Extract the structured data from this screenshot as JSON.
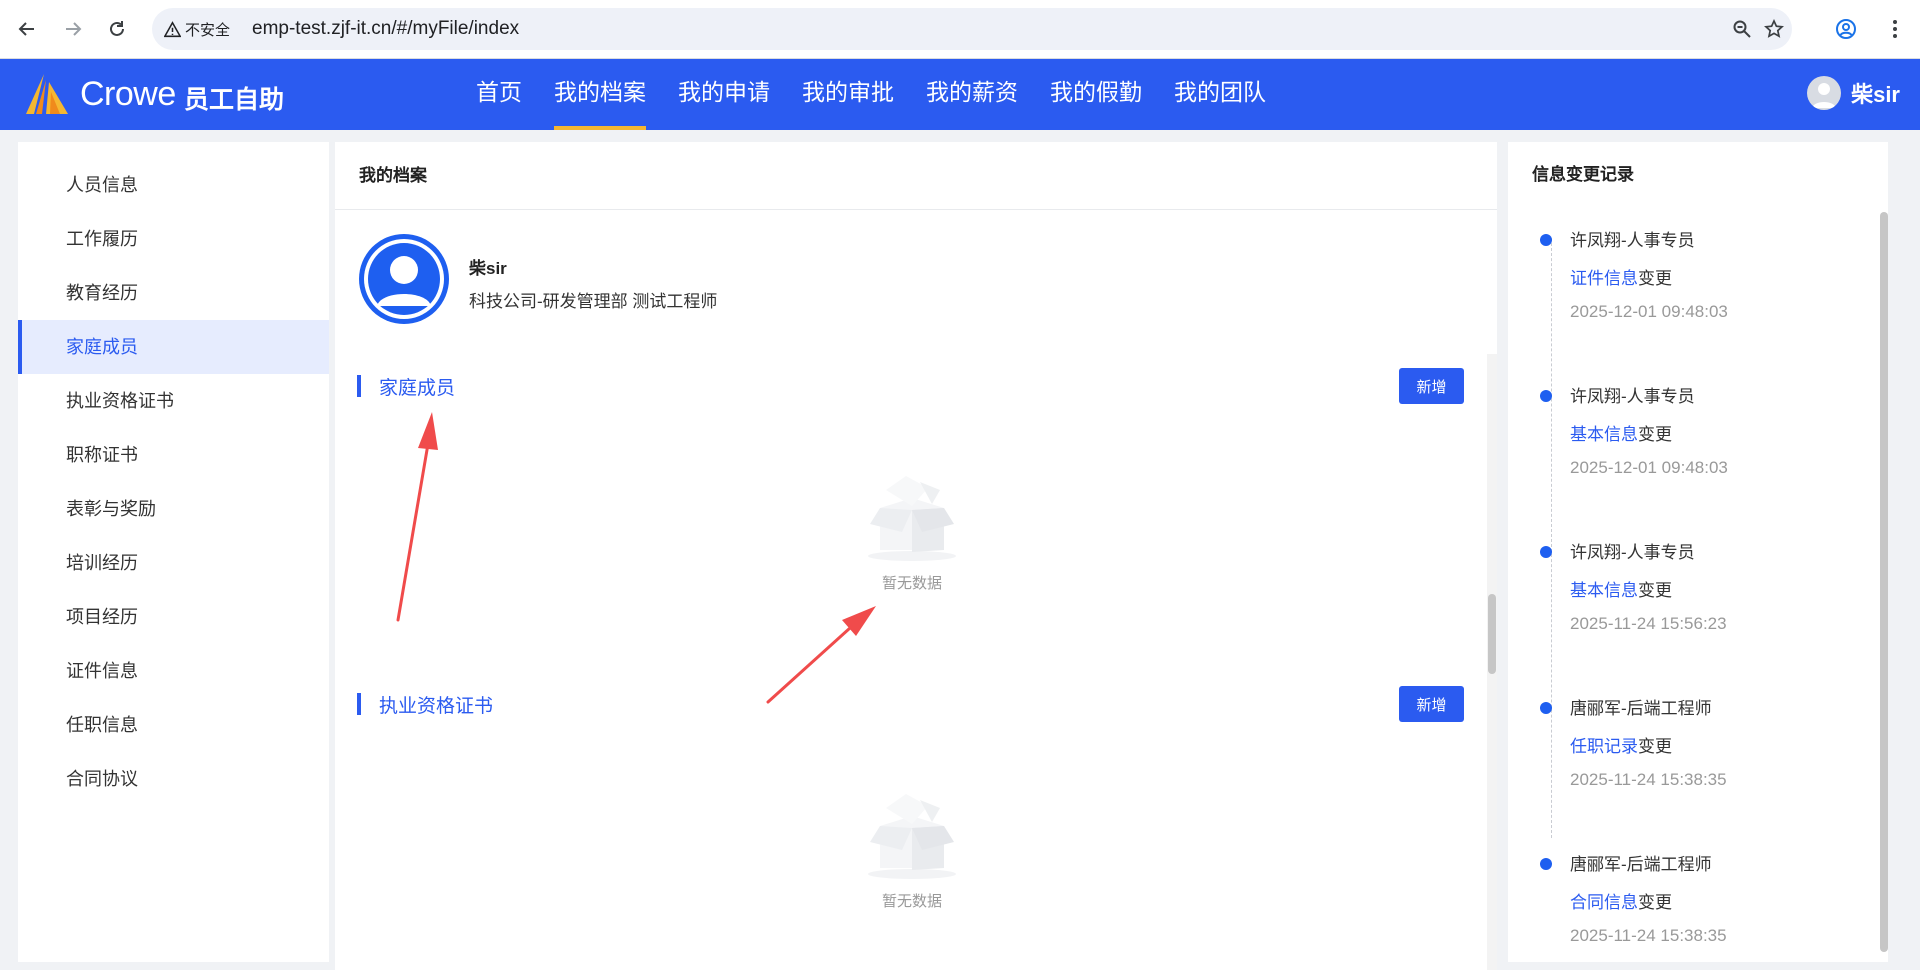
{
  "browser": {
    "security_label": "不安全",
    "url": "emp-test.zjf-it.cn/#/myFile/index"
  },
  "header": {
    "logo_text": "Crowe",
    "logo_sub": "员工自助",
    "nav": [
      {
        "label": "首页"
      },
      {
        "label": "我的档案"
      },
      {
        "label": "我的申请"
      },
      {
        "label": "我的审批"
      },
      {
        "label": "我的薪资"
      },
      {
        "label": "我的假勤"
      },
      {
        "label": "我的团队"
      }
    ],
    "active_nav": "我的档案",
    "user_name": "柴sir",
    "brand_color": "#2b5bf0",
    "active_underline_color": "#f5b731"
  },
  "sidebar": {
    "items": [
      {
        "label": "人员信息"
      },
      {
        "label": "工作履历"
      },
      {
        "label": "教育经历"
      },
      {
        "label": "家庭成员"
      },
      {
        "label": "执业资格证书"
      },
      {
        "label": "职称证书"
      },
      {
        "label": "表彰与奖励"
      },
      {
        "label": "培训经历"
      },
      {
        "label": "项目经历"
      },
      {
        "label": "证件信息"
      },
      {
        "label": "任职信息"
      },
      {
        "label": "合同协议"
      }
    ],
    "active_item": "家庭成员"
  },
  "main": {
    "title": "我的档案",
    "profile": {
      "name": "柴sir",
      "dept": "科技公司-研发管理部 测试工程师"
    },
    "sections": [
      {
        "title": "家庭成员",
        "add_label": "新增",
        "empty_text": "暂无数据"
      },
      {
        "title": "执业资格证书",
        "add_label": "新增",
        "empty_text": "暂无数据"
      }
    ]
  },
  "right": {
    "title": "信息变更记录",
    "records": [
      {
        "who": "许凤翔-人事专员",
        "link": "证件信息",
        "suffix": "变更",
        "time": "2025-12-01 09:48:03"
      },
      {
        "who": "许凤翔-人事专员",
        "link": "基本信息",
        "suffix": "变更",
        "time": "2025-12-01 09:48:03"
      },
      {
        "who": "许凤翔-人事专员",
        "link": "基本信息",
        "suffix": "变更",
        "time": "2025-11-24 15:56:23"
      },
      {
        "who": "唐郦军-后端工程师",
        "link": "任职记录",
        "suffix": "变更",
        "time": "2025-11-24 15:38:35"
      },
      {
        "who": "唐郦军-后端工程师",
        "link": "合同信息",
        "suffix": "变更",
        "time": "2025-11-24 15:38:35"
      }
    ]
  },
  "annotation_color": "#f04b4b"
}
